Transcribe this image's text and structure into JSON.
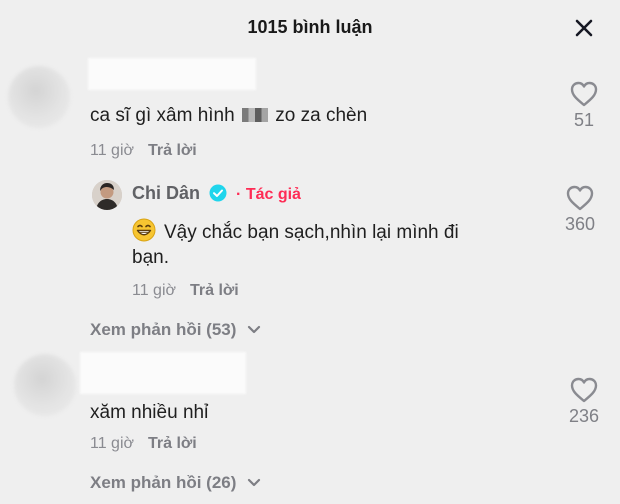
{
  "header": {
    "title": "1015 bình luận"
  },
  "comments": [
    {
      "text_before": "ca sĩ gì xâm hình",
      "text_after": "zo za chèn",
      "time": "11 giờ",
      "reply": "Trả lời",
      "likes": "51",
      "view_replies": "Xem phản hồi (53)",
      "reply_thread": {
        "author": "Chi Dân",
        "author_tag": "· Tác giả",
        "text_line1": "Vậy chắc bạn sạch,nhìn lại mình đi",
        "text_line2": "bạn.",
        "time": "11 giờ",
        "reply": "Trả lời",
        "likes": "360"
      }
    },
    {
      "text": "xăm nhiều nhỉ",
      "time": "11 giờ",
      "reply": "Trả lời",
      "likes": "236",
      "view_replies": "Xem phản hồi (26)"
    }
  ],
  "colors": {
    "background": "#efefef",
    "author_tag": "#fe2c55",
    "verified": "#20d5ec",
    "muted": "#8a8b91"
  },
  "icons": [
    "close-icon",
    "heart-outline-icon",
    "verified-badge-icon",
    "grin-emoji-icon",
    "chevron-down-icon"
  ]
}
